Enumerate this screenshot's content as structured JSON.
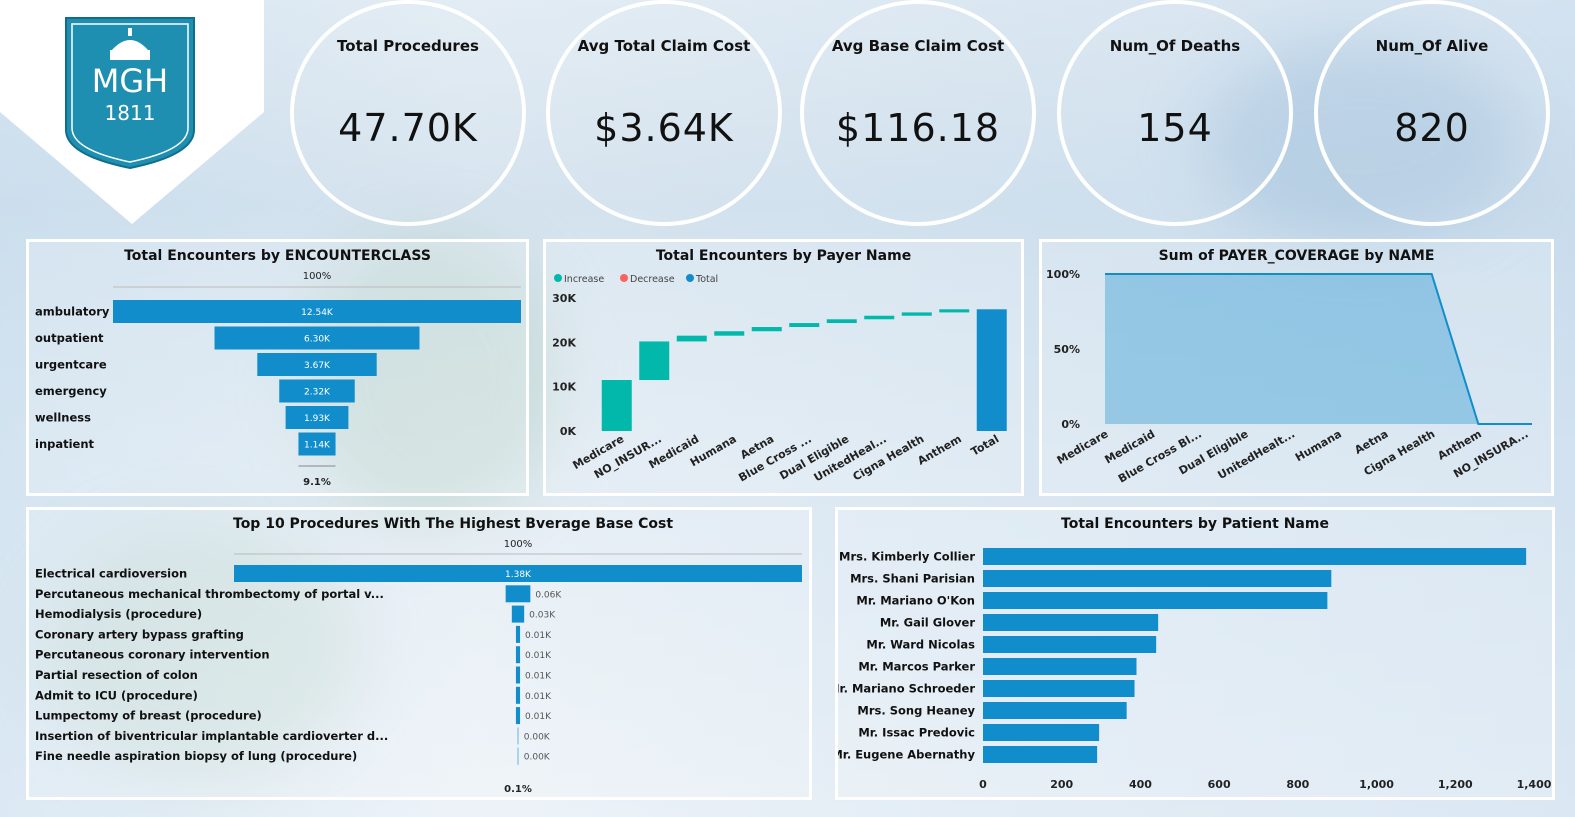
{
  "logo": {
    "text": "MGH",
    "year": "1811"
  },
  "kpis": [
    {
      "title": "Total Procedures",
      "value": "47.70K"
    },
    {
      "title": "Avg Total Claim Cost",
      "value": "$3.64K"
    },
    {
      "title": "Avg Base Claim Cost",
      "value": "$116.18"
    },
    {
      "title": "Num_Of Deaths",
      "value": "154"
    },
    {
      "title": "Num_Of Alive",
      "value": "820"
    }
  ],
  "panels": {
    "funnel1_title": "Total Encounters by ENCOUNTERCLASS",
    "waterfall_title": "Total Encounters by Payer Name",
    "area_title": "Sum of PAYER_COVERAGE by NAME",
    "funnel2_title": "Top 10 Procedures With The Highest Bverage Base Cost",
    "hbar_title": "Total Encounters by Patient Name"
  },
  "chart_data": [
    {
      "type": "bar",
      "title": "Total Encounters by ENCOUNTERCLASS",
      "categories": [
        "ambulatory",
        "outpatient",
        "urgentcare",
        "emergency",
        "wellness",
        "inpatient"
      ],
      "values": [
        12540,
        6300,
        3670,
        2320,
        1930,
        1140
      ],
      "labels": [
        "12.54K",
        "6.30K",
        "3.67K",
        "2.32K",
        "1.93K",
        "1.14K"
      ],
      "top_label": "100%",
      "bottom_label": "9.1%",
      "color": "#118DCC"
    },
    {
      "type": "bar",
      "title": "Total Encounters by Payer Name",
      "legend": [
        "Increase",
        "Decrease",
        "Total"
      ],
      "legend_colors": [
        "#01B8AA",
        "#FD625E",
        "#118DCC"
      ],
      "categories": [
        "Medicare",
        "NO_INSUR...",
        "Medicaid",
        "Humana",
        "Aetna",
        "Blue Cross ...",
        "Dual Eligible",
        "UnitedHeal...",
        "Cigna Health",
        "Anthem",
        "Total"
      ],
      "values": [
        11500,
        8700,
        1300,
        1000,
        950,
        900,
        850,
        800,
        750,
        700,
        27450
      ],
      "yticks": [
        "0K",
        "10K",
        "20K",
        "30K"
      ],
      "ylim": [
        0,
        30000
      ]
    },
    {
      "type": "area",
      "title": "Sum of PAYER_COVERAGE by NAME",
      "categories": [
        "Medicare",
        "Medicaid",
        "Blue Cross Bl...",
        "Dual Eligible",
        "UnitedHealt...",
        "Humana",
        "Aetna",
        "Cigna Health",
        "Anthem",
        "NO_INSURA..."
      ],
      "values": [
        1,
        1,
        1,
        1,
        1,
        1,
        1,
        1,
        0,
        0
      ],
      "yticks": [
        "0%",
        "50%",
        "100%"
      ],
      "ylim": [
        0,
        1
      ],
      "color": "#118DCC"
    },
    {
      "type": "bar",
      "title": "Top 10 Procedures With The Highest Bverage Base Cost",
      "categories": [
        "Electrical cardioversion",
        "Percutaneous mechanical thrombectomy of portal v...",
        "Hemodialysis (procedure)",
        "Coronary artery bypass grafting",
        "Percutaneous coronary intervention",
        "Partial resection of colon",
        "Admit to ICU (procedure)",
        "Lumpectomy of breast (procedure)",
        "Insertion of biventricular implantable cardioverter d...",
        "Fine needle aspiration biopsy of lung (procedure)"
      ],
      "values": [
        1380,
        60,
        30,
        10,
        10,
        10,
        10,
        10,
        0,
        0
      ],
      "labels": [
        "1.38K",
        "0.06K",
        "0.03K",
        "0.01K",
        "0.01K",
        "0.01K",
        "0.01K",
        "0.01K",
        "0.00K",
        "0.00K"
      ],
      "top_label": "100%",
      "bottom_label": "0.1%",
      "color": "#118DCC"
    },
    {
      "type": "bar",
      "title": "Total Encounters by Patient Name",
      "categories": [
        "Mrs. Kimberly Collier",
        "Mrs. Shani Parisian",
        "Mr. Mariano O'Kon",
        "Mr. Gail Glover",
        "Mr. Ward Nicolas",
        "Mr. Marcos Parker",
        "Mr. Mariano Schroeder",
        "Mrs. Song Heaney",
        "Mr. Issac Predovic",
        "Mr. Eugene Abernathy"
      ],
      "values": [
        1380,
        885,
        875,
        445,
        440,
        390,
        385,
        365,
        295,
        290
      ],
      "xticks": [
        "0",
        "200",
        "400",
        "600",
        "800",
        "1,000",
        "1,200",
        "1,400"
      ],
      "xlim": [
        0,
        1400
      ],
      "color": "#118DCC"
    }
  ]
}
